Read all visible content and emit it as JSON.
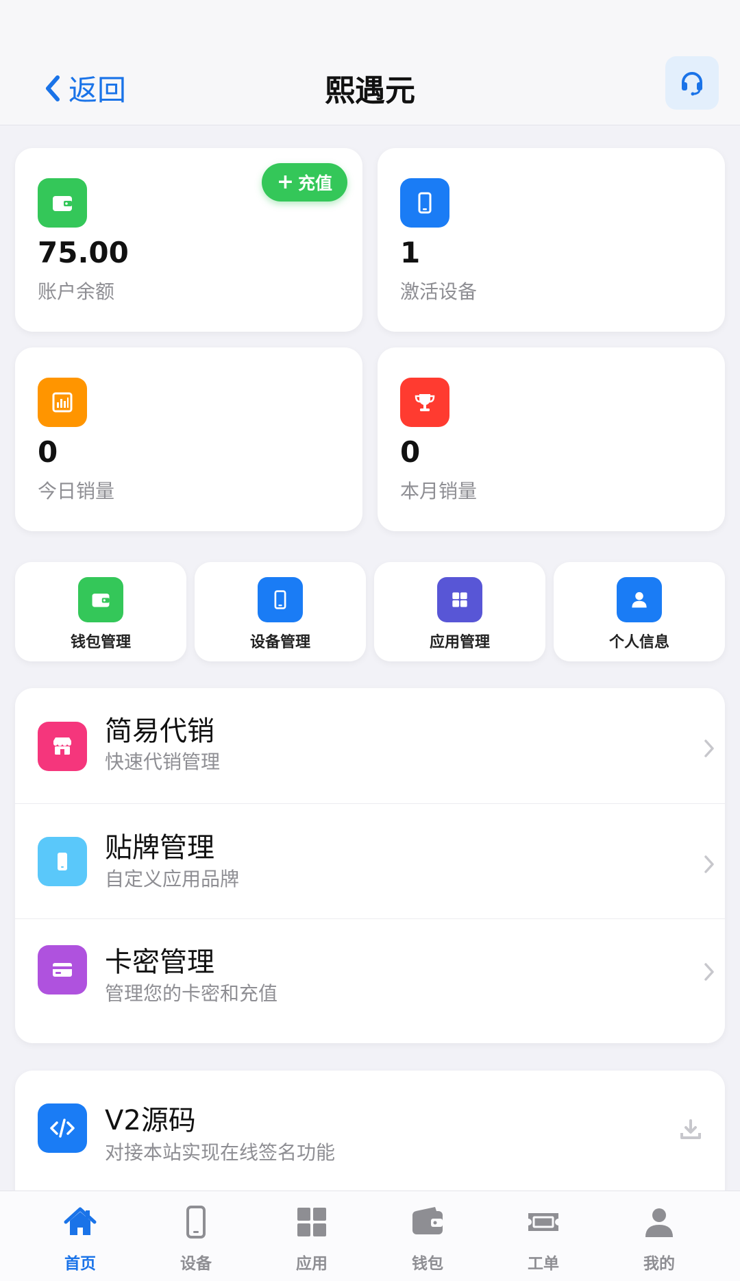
{
  "header": {
    "back_label": "返回",
    "title": "熙遇元"
  },
  "stats": [
    {
      "value": "75.00",
      "label": "账户余额",
      "icon": "wallet-icon",
      "color": "#34c759"
    },
    {
      "value": "1",
      "label": "激活设备",
      "icon": "phone-icon",
      "color": "#1a7cf5"
    },
    {
      "value": "0",
      "label": "今日销量",
      "icon": "bar-chart-icon",
      "color": "#ff9500"
    },
    {
      "value": "0",
      "label": "本月销量",
      "icon": "trophy-icon",
      "color": "#ff3b30"
    }
  ],
  "recharge": {
    "plus": "+",
    "label": "充值"
  },
  "quick_actions": [
    {
      "label": "钱包管理",
      "icon": "wallet-icon",
      "color": "#34c759"
    },
    {
      "label": "设备管理",
      "icon": "phone-icon",
      "color": "#1a7cf5"
    },
    {
      "label": "应用管理",
      "icon": "apps-grid-icon",
      "color": "#5856d6"
    },
    {
      "label": "个人信息",
      "icon": "user-icon",
      "color": "#1a7cf5"
    }
  ],
  "menu": [
    {
      "title": "简易代销",
      "subtitle": "快速代销管理",
      "icon": "store-icon",
      "color": "#f5367c"
    },
    {
      "title": "贴牌管理",
      "subtitle": "自定义应用品牌",
      "icon": "phone-icon",
      "color": "#5ac8fa"
    },
    {
      "title": "卡密管理",
      "subtitle": "管理您的卡密和充值",
      "icon": "credit-card-icon",
      "color": "#af52de"
    }
  ],
  "source": {
    "title": "V2源码",
    "subtitle": "对接本站实现在线签名功能",
    "icon": "code-icon",
    "action_icon": "download-icon"
  },
  "tabbar": {
    "active_color": "#1a73e8",
    "inactive_color": "#8e8e93",
    "items": [
      {
        "label": "首页",
        "icon": "home-icon",
        "active": true
      },
      {
        "label": "设备",
        "icon": "phone-icon",
        "active": false
      },
      {
        "label": "应用",
        "icon": "apps-grid-icon",
        "active": false
      },
      {
        "label": "钱包",
        "icon": "wallet-icon",
        "active": false
      },
      {
        "label": "工单",
        "icon": "ticket-icon",
        "active": false
      },
      {
        "label": "我的",
        "icon": "user-icon",
        "active": false
      }
    ]
  }
}
